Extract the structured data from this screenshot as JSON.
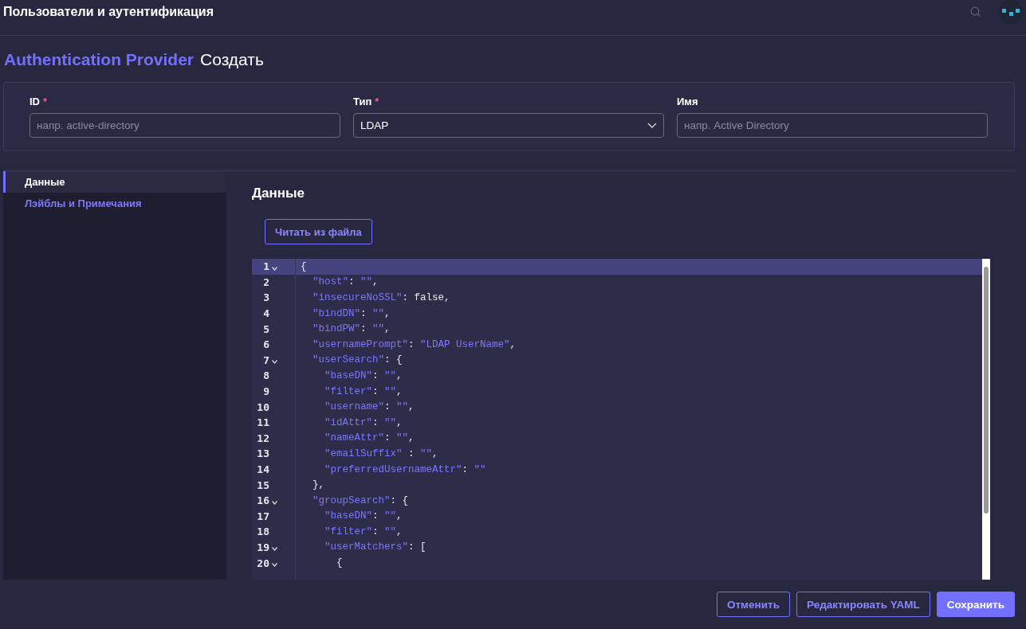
{
  "header": {
    "title": "Пользователи и аутентификация"
  },
  "page_title": {
    "resource": "Authentication Provider",
    "action": "Создать"
  },
  "form": {
    "fields": [
      {
        "kind": "text",
        "label": "ID",
        "required_mark": "*",
        "placeholder": "напр. active-directory"
      },
      {
        "kind": "select",
        "label": "Тип",
        "required_mark": "*",
        "value": "LDAP"
      },
      {
        "kind": "text",
        "label": "Имя",
        "placeholder": "напр. Active Directory"
      }
    ]
  },
  "sidebar": {
    "items": [
      {
        "label": "Данные",
        "selected": true
      },
      {
        "label": "Лэйблы и Примечания",
        "selected": false
      }
    ]
  },
  "section": {
    "title": "Данные",
    "read_button": "Читать из файла"
  },
  "editor": {
    "lines": [
      {
        "number": "1",
        "foldable": true,
        "active": true,
        "text": "{"
      },
      {
        "number": "2",
        "foldable": false,
        "active": false,
        "text": "  \"host\": \"\","
      },
      {
        "number": "3",
        "foldable": false,
        "active": false,
        "text": "  \"insecureNoSSL\": false,"
      },
      {
        "number": "4",
        "foldable": false,
        "active": false,
        "text": "  \"bindDN\": \"\","
      },
      {
        "number": "5",
        "foldable": false,
        "active": false,
        "text": "  \"bindPW\": \"\","
      },
      {
        "number": "6",
        "foldable": false,
        "active": false,
        "text": "  \"usernamePrompt\": \"LDAP UserName\","
      },
      {
        "number": "7",
        "foldable": true,
        "active": false,
        "text": "  \"userSearch\": {"
      },
      {
        "number": "8",
        "foldable": false,
        "active": false,
        "text": "    \"baseDN\": \"\","
      },
      {
        "number": "9",
        "foldable": false,
        "active": false,
        "text": "    \"filter\": \"\","
      },
      {
        "number": "10",
        "foldable": false,
        "active": false,
        "text": "    \"username\": \"\","
      },
      {
        "number": "11",
        "foldable": false,
        "active": false,
        "text": "    \"idAttr\": \"\","
      },
      {
        "number": "12",
        "foldable": false,
        "active": false,
        "text": "    \"nameAttr\": \"\","
      },
      {
        "number": "13",
        "foldable": false,
        "active": false,
        "text": "    \"emailSuffix\" : \"\","
      },
      {
        "number": "14",
        "foldable": false,
        "active": false,
        "text": "    \"preferredUsernameAttr\": \"\""
      },
      {
        "number": "15",
        "foldable": false,
        "active": false,
        "text": "  },"
      },
      {
        "number": "16",
        "foldable": true,
        "active": false,
        "text": "  \"groupSearch\": {"
      },
      {
        "number": "17",
        "foldable": false,
        "active": false,
        "text": "    \"baseDN\": \"\","
      },
      {
        "number": "18",
        "foldable": false,
        "active": false,
        "text": "    \"filter\": \"\","
      },
      {
        "number": "19",
        "foldable": true,
        "active": false,
        "text": "    \"userMatchers\": ["
      },
      {
        "number": "20",
        "foldable": true,
        "active": false,
        "text": "      {"
      }
    ]
  },
  "footer": {
    "buttons": [
      {
        "kind": "secondary",
        "label": "Отменить"
      },
      {
        "kind": "secondary",
        "label": "Редактировать YAML"
      },
      {
        "kind": "primary",
        "label": "Сохранить"
      }
    ]
  }
}
